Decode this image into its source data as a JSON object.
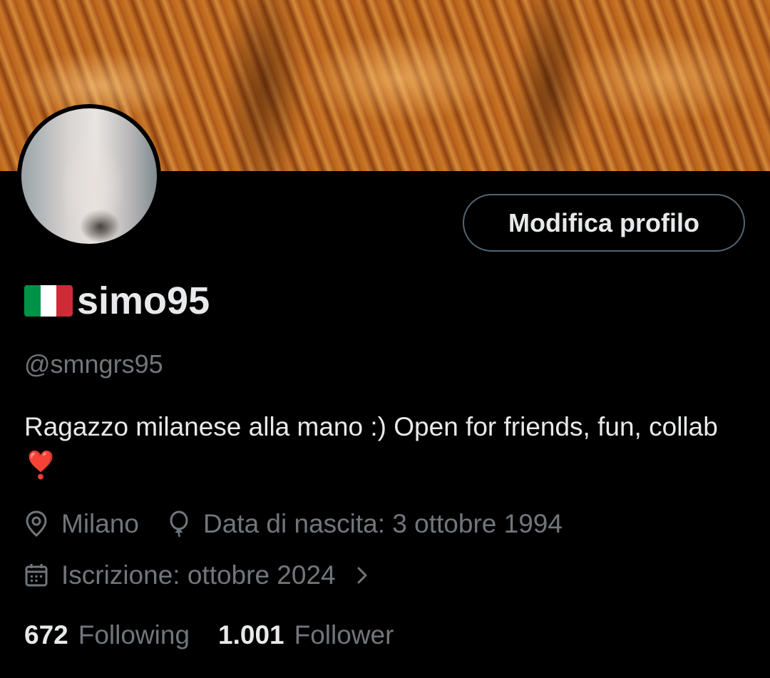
{
  "profile": {
    "edit_button": "Modifica profilo",
    "flag_emoji": "🇮🇹",
    "display_name": "simo95",
    "handle": "@smngrs95",
    "bio": "Ragazzo milanese alla mano :)  Open for friends, fun, collab",
    "bio_emoji": "❣️",
    "location": "Milano",
    "birthday": "Data di nascita: 3 ottobre 1994",
    "joined": "Iscrizione: ottobre 2024",
    "following_count": "672",
    "following_label": "Following",
    "followers_count": "1.001",
    "followers_label": "Follower"
  },
  "icons": {
    "location": "location-pin-icon",
    "birthday": "balloon-icon",
    "joined": "calendar-icon",
    "chevron": "chevron-right-icon"
  },
  "colors": {
    "background": "#000000",
    "text_primary": "#e7e9ea",
    "text_secondary": "#71767b",
    "button_border": "#536471",
    "heart": "#e0245e",
    "flag_green": "#009246",
    "flag_white": "#ffffff",
    "flag_red": "#ce2b37"
  }
}
